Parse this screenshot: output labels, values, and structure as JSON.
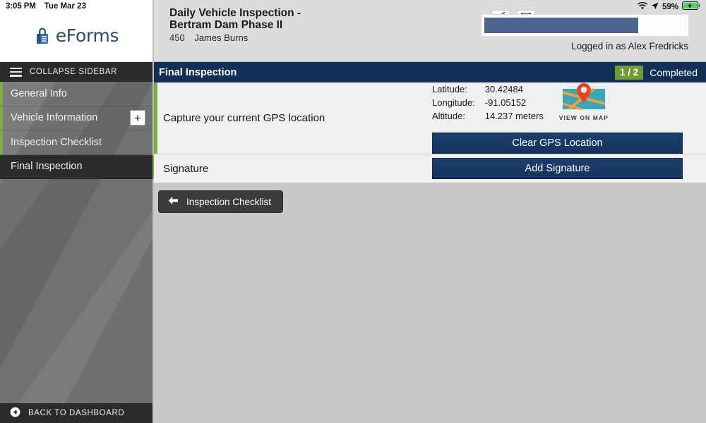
{
  "status_bar": {
    "time": "3:05 PM",
    "date": "Tue Mar 23",
    "battery_percent": "59%",
    "wifi_icon": "wifi-icon",
    "location_icon": "location-arrow-icon",
    "battery_icon": "battery-charging-icon"
  },
  "brand": {
    "name": "eForms",
    "logo_icon": "padlock-icon"
  },
  "sidebar": {
    "collapse_label": "COLLAPSE SIDEBAR",
    "menu_icon": "hamburger-icon",
    "items": [
      {
        "label": "General Info",
        "active": false,
        "has_plus": false
      },
      {
        "label": "Vehicle Information",
        "active": false,
        "has_plus": true,
        "plus_label": "+"
      },
      {
        "label": "Inspection Checklist",
        "active": false,
        "has_plus": false
      },
      {
        "label": "Final Inspection",
        "active": true,
        "has_plus": false
      }
    ],
    "dashboard_label": "BACK TO DASHBOARD",
    "dashboard_icon": "back-circle-icon"
  },
  "header": {
    "title": "Daily Vehicle Inspection - Bertram Dam Phase II",
    "sub_number": "450",
    "sub_name": "James  Burns",
    "edit_icon": "pencil-icon",
    "mail_icon": "envelope-icon",
    "logged_in": "Logged in as Alex Fredricks"
  },
  "section": {
    "title": "Final Inspection",
    "progress": "1 / 2",
    "completed_label": "Completed",
    "accent_color": "#6f9c33",
    "bar_color": "#123055"
  },
  "gps": {
    "label": "Capture your current GPS location",
    "fields": [
      {
        "key": "Latitude:",
        "value": "30.42484"
      },
      {
        "key": "Longitude:",
        "value": "-91.05152"
      },
      {
        "key": "Altitude:",
        "value": "14.237 meters"
      }
    ],
    "map_icon": "map-pin-icon",
    "map_caption": "VIEW ON MAP",
    "clear_button": "Clear GPS Location"
  },
  "signature": {
    "label": "Signature",
    "add_button": "Add Signature"
  },
  "footer": {
    "back_label": "Inspection Checklist",
    "back_icon": "arrow-left-icon"
  }
}
